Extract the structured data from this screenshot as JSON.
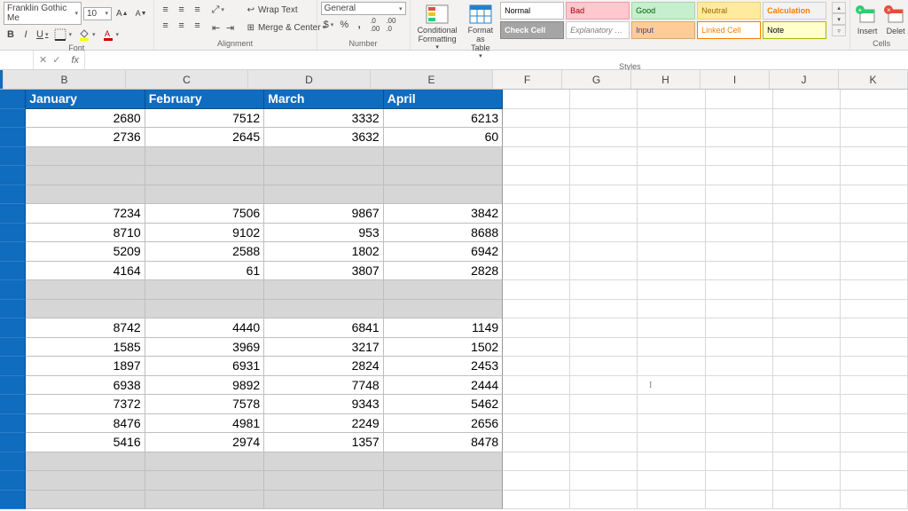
{
  "ribbon": {
    "font": {
      "name": "Franklin Gothic Me",
      "size": "10",
      "inc_a": "A▴",
      "dec_a": "A▾",
      "bold": "B",
      "italic": "I",
      "underline": "U",
      "label": "Font"
    },
    "alignment": {
      "wrap": "Wrap Text",
      "merge": "Merge & Center",
      "label": "Alignment"
    },
    "number": {
      "format": "General",
      "currency": "$",
      "percent": "%",
      "comma": ",",
      "inc": ".0←",
      "dec": "→.0",
      "label": "Number"
    },
    "styles": {
      "cond": "Conditional\nFormatting",
      "table": "Format as\nTable",
      "cells": [
        {
          "t": "Normal",
          "bg": "#ffffff",
          "fg": "#000",
          "bd": "#bbb"
        },
        {
          "t": "Bad",
          "bg": "#ffc7ce",
          "fg": "#9c0006",
          "bd": "#e8a0a8"
        },
        {
          "t": "Good",
          "bg": "#c6efce",
          "fg": "#006100",
          "bd": "#a0d8aa"
        },
        {
          "t": "Neutral",
          "bg": "#ffeb9c",
          "fg": "#9c6500",
          "bd": "#e8d080"
        },
        {
          "t": "Calculation",
          "bg": "#f2f2f2",
          "fg": "#fa7d00",
          "bd": "#ccc",
          "b": true
        },
        {
          "t": "Check Cell",
          "bg": "#a5a5a5",
          "fg": "#fff",
          "bd": "#888",
          "b": true
        },
        {
          "t": "Explanatory …",
          "bg": "#fff",
          "fg": "#7f7f7f",
          "bd": "#ccc",
          "i": true
        },
        {
          "t": "Input",
          "bg": "#ffcc99",
          "fg": "#3f3f76",
          "bd": "#d8a870"
        },
        {
          "t": "Linked Cell",
          "bg": "#fff",
          "fg": "#fa7d00",
          "bd": "#fa7d00"
        },
        {
          "t": "Note",
          "bg": "#ffffcc",
          "fg": "#000",
          "bd": "#b2b200"
        }
      ],
      "label": "Styles"
    },
    "cells": {
      "insert": "Insert",
      "delete": "Delet",
      "label": "Cells"
    }
  },
  "formula_bar": {
    "cancel": "✕",
    "confirm": "✓",
    "fx": "fx"
  },
  "columns": {
    "wide": [
      "B",
      "C",
      "D",
      "E"
    ],
    "narrow": [
      "F",
      "G",
      "H",
      "I",
      "J",
      "K"
    ]
  },
  "chart_data": {
    "type": "table",
    "headers": [
      "January",
      "February",
      "March",
      "April"
    ],
    "rows": [
      [
        2680,
        7512,
        3332,
        6213
      ],
      [
        2736,
        2645,
        3632,
        60
      ],
      null,
      null,
      null,
      [
        7234,
        7506,
        9867,
        3842
      ],
      [
        8710,
        9102,
        953,
        8688
      ],
      [
        5209,
        2588,
        1802,
        6942
      ],
      [
        4164,
        61,
        3807,
        2828
      ],
      null,
      null,
      [
        8742,
        4440,
        6841,
        1149
      ],
      [
        1585,
        3969,
        3217,
        1502
      ],
      [
        1897,
        6931,
        2824,
        2453
      ],
      [
        6938,
        9892,
        7748,
        2444
      ],
      [
        7372,
        7578,
        9343,
        5462
      ],
      [
        8476,
        4981,
        2249,
        2656
      ],
      [
        5416,
        2974,
        1357,
        8478
      ],
      null,
      null,
      null
    ]
  }
}
